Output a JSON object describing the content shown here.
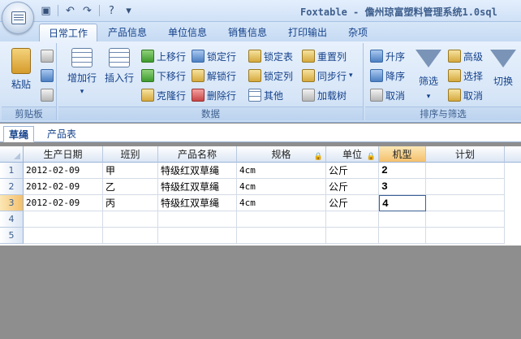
{
  "window": {
    "title": "Foxtable - 儋州琼富塑料管理系统1.0sql"
  },
  "quick_access": [
    "save-icon",
    "undo-icon",
    "redo-icon",
    "help-icon",
    "dropdown-icon"
  ],
  "tabs": [
    "日常工作",
    "产品信息",
    "单位信息",
    "销售信息",
    "打印输出",
    "杂项"
  ],
  "ribbon": {
    "clipboard": {
      "label": "剪贴板",
      "paste": "粘贴"
    },
    "data": {
      "label": "数据",
      "add_row": "增加行",
      "insert_row": "插入行",
      "move_up": "上移行",
      "move_down": "下移行",
      "clone_row": "克隆行",
      "lock_row": "锁定行",
      "unlock_row": "解锁行",
      "delete_row": "删除行",
      "lock_table": "锁定表",
      "lock_column": "锁定列",
      "other": "其他",
      "reset_column": "重置列",
      "sync_row": "同步行",
      "load_tree": "加载树"
    },
    "sort_filter": {
      "label": "排序与筛选",
      "ascending": "升序",
      "descending": "降序",
      "cancel_sort": "取消",
      "filter": "筛选",
      "advanced": "高级",
      "select": "选择",
      "cancel_filter": "取消",
      "toggle": "切换"
    }
  },
  "sheet_tabs": [
    "草绳",
    "产品表"
  ],
  "table": {
    "columns": [
      "生产日期",
      "班别",
      "产品名称",
      "规格",
      "单位",
      "机型",
      "计划"
    ],
    "rows": [
      {
        "num": "1",
        "date": "2012-02-09",
        "shift": "甲",
        "product": "特级红双草绳",
        "spec": "4cm",
        "unit": "公斤",
        "model": "2",
        "plan": ""
      },
      {
        "num": "2",
        "date": "2012-02-09",
        "shift": "乙",
        "product": "特级红双草绳",
        "spec": "4cm",
        "unit": "公斤",
        "model": "3",
        "plan": ""
      },
      {
        "num": "3",
        "date": "2012-02-09",
        "shift": "丙",
        "product": "特级红双草绳",
        "spec": "4cm",
        "unit": "公斤",
        "model": "4",
        "plan": ""
      },
      {
        "num": "4",
        "date": "",
        "shift": "",
        "product": "",
        "spec": "",
        "unit": "",
        "model": "",
        "plan": ""
      },
      {
        "num": "5",
        "date": "",
        "shift": "",
        "product": "",
        "spec": "",
        "unit": "",
        "model": "",
        "plan": ""
      }
    ]
  }
}
